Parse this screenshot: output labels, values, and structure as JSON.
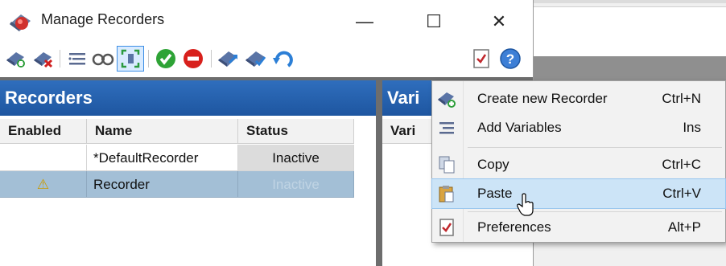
{
  "window": {
    "title": "Manage Recorders",
    "controls": {
      "minimize": "—",
      "maximize": "☐",
      "close": "✕"
    }
  },
  "toolbar": {
    "icons": [
      "add-recorder-icon",
      "delete-recorder-icon",
      "variables-list-icon",
      "view-icon",
      "select-frame-icon",
      "enable-icon",
      "disable-icon",
      "export-icon",
      "import-icon",
      "undo-icon",
      "preferences-icon",
      "help-icon"
    ]
  },
  "recorders_panel": {
    "title": "Recorders",
    "columns": [
      "Enabled",
      "Name",
      "Status"
    ],
    "rows": [
      {
        "enabled": "",
        "name": "*DefaultRecorder",
        "status": "Inactive"
      },
      {
        "enabled": "⚠",
        "name": "Recorder",
        "status": "Inactive"
      }
    ]
  },
  "variables_panel": {
    "title": "Vari",
    "column": "Vari"
  },
  "context_menu": {
    "items": [
      {
        "label": "Create new Recorder",
        "shortcut": "Ctrl+N",
        "icon": "create-recorder-icon"
      },
      {
        "label": "Add Variables",
        "shortcut": "Ins",
        "icon": "add-variables-icon"
      },
      {
        "label": "Copy",
        "shortcut": "Ctrl+C",
        "icon": "copy-icon"
      },
      {
        "label": "Paste",
        "shortcut": "Ctrl+V",
        "icon": "paste-icon"
      },
      {
        "label": "Preferences",
        "shortcut": "Alt+P",
        "icon": "preferences-icon"
      }
    ]
  },
  "colors": {
    "header_blue": "#1e56a0",
    "selected_row": "#a3bfd6",
    "menu_hover": "#cce4f7"
  }
}
